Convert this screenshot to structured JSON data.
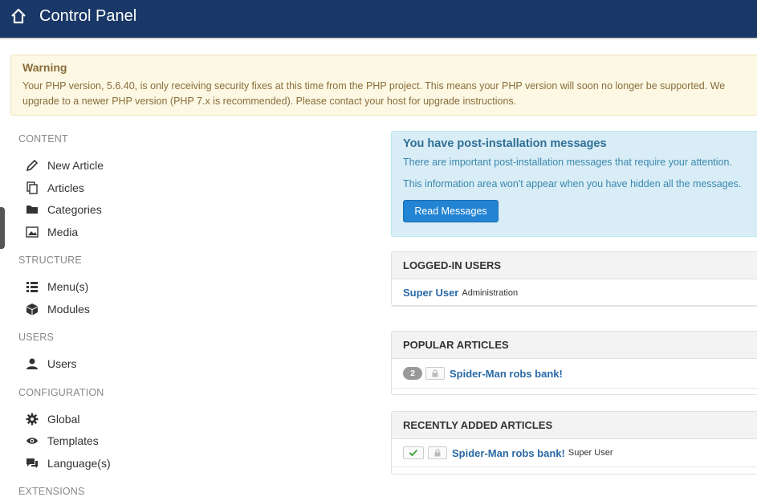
{
  "header": {
    "title": "Control Panel",
    "home_icon": "home-icon"
  },
  "warning": {
    "title": "Warning",
    "line1": "Your PHP version, 5.6.40, is only receiving security fixes at this time from the PHP project. This means your PHP version will soon no longer be supported. We",
    "line2": "upgrade to a newer PHP version (PHP 7.x is recommended). Please contact your host for upgrade instructions."
  },
  "sidebar": {
    "content": {
      "heading": "CONTENT",
      "items": [
        {
          "label": "New Article",
          "icon": "pencil-icon"
        },
        {
          "label": "Articles",
          "icon": "copy-icon"
        },
        {
          "label": "Categories",
          "icon": "folder-icon"
        },
        {
          "label": "Media",
          "icon": "image-icon"
        }
      ]
    },
    "structure": {
      "heading": "STRUCTURE",
      "items": [
        {
          "label": "Menu(s)",
          "icon": "list-icon"
        },
        {
          "label": "Modules",
          "icon": "cube-icon"
        }
      ]
    },
    "users": {
      "heading": "USERS",
      "items": [
        {
          "label": "Users",
          "icon": "user-icon"
        }
      ]
    },
    "configuration": {
      "heading": "CONFIGURATION",
      "items": [
        {
          "label": "Global",
          "icon": "gear-icon"
        },
        {
          "label": "Templates",
          "icon": "eye-icon"
        },
        {
          "label": "Language(s)",
          "icon": "comments-icon"
        }
      ]
    },
    "extensions": {
      "heading": "EXTENSIONS"
    }
  },
  "postinstall": {
    "title": "You have post-installation messages",
    "text1": "There are important post-installation messages that require your attention.",
    "text2": "This information area won't appear when you have hidden all the messages.",
    "button": "Read Messages"
  },
  "logged_in": {
    "title": "LOGGED-IN USERS",
    "user": "Super User",
    "area": "Administration"
  },
  "popular": {
    "title": "POPULAR ARTICLES",
    "hits": "2",
    "article": "Spider-Man robs bank!"
  },
  "recent": {
    "title": "RECENTLY ADDED ARTICLES",
    "article": "Spider-Man robs bank!",
    "author": "Super User"
  }
}
